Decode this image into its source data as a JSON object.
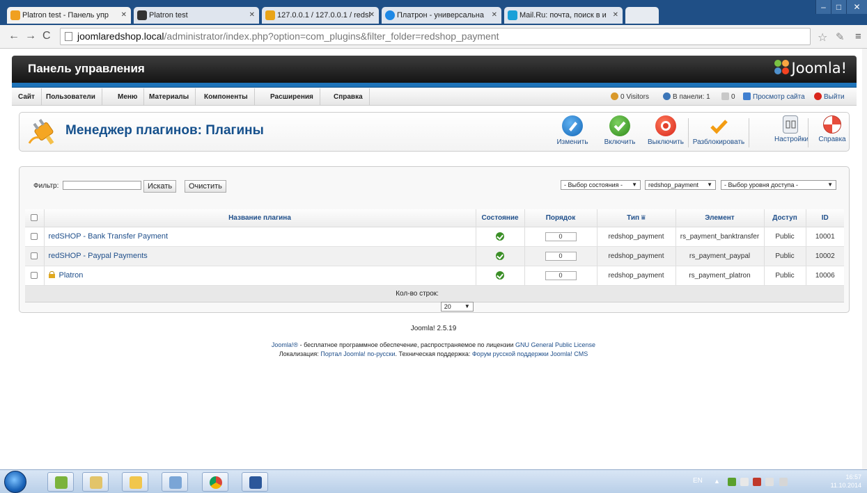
{
  "browser": {
    "tabs": [
      {
        "title": "Platron test - Панель упр",
        "favicon_color": "#f0a020"
      },
      {
        "title": "Platron test",
        "favicon_color": "#333333"
      },
      {
        "title": "127.0.0.1 / 127.0.0.1 / redsl",
        "favicon_color": "#e9a418"
      },
      {
        "title": "Платрон - универсальна",
        "favicon_color": "#1e88e5"
      },
      {
        "title": "Mail.Ru: почта, поиск в и",
        "favicon_color": "#1ba0d8"
      }
    ],
    "address_host": "joomlaredshop.local",
    "address_path": "/administrator/index.php?option=com_plugins&filter_folder=redshop_payment"
  },
  "header": {
    "title": "Панель управления",
    "logo_text": "Joomla!"
  },
  "menu": {
    "items": [
      "Сайт",
      "Пользователи",
      "Меню",
      "Материалы",
      "Компоненты",
      "Расширения",
      "Справка"
    ],
    "visitors": "0 Visitors",
    "in_panel": "В панели: 1",
    "messages": "0",
    "view_site": "Просмотр сайта",
    "logout": "Выйти"
  },
  "toolbar": {
    "title": "Менеджер плагинов: Плагины",
    "buttons": {
      "edit": "Изменить",
      "enable": "Включить",
      "disable": "Выключить",
      "unlock": "Разблокировать",
      "options": "Настройки",
      "help": "Справка"
    }
  },
  "filter": {
    "label": "Фильтр:",
    "value": "",
    "search_button": "Искать",
    "clear_button": "Очистить",
    "state_select": "- Выбор состояния -",
    "folder_select": "redshop_payment",
    "access_select": "- Выбор уровня доступа -"
  },
  "table": {
    "headers": {
      "name": "Название плагина",
      "state": "Состояние",
      "ordering": "Порядок",
      "type": "Тип",
      "element": "Элемент",
      "access": "Доступ",
      "id": "ID"
    },
    "rows": [
      {
        "name": "redSHOP - Bank Transfer Payment",
        "ordering": "0",
        "type": "redshop_payment",
        "element": "rs_payment_banktransfer",
        "access": "Public",
        "id": "10001",
        "locked": false
      },
      {
        "name": "redSHOP - Paypal Payments",
        "ordering": "0",
        "type": "redshop_payment",
        "element": "rs_payment_paypal",
        "access": "Public",
        "id": "10002",
        "locked": false
      },
      {
        "name": "Platron",
        "ordering": "0",
        "type": "redshop_payment",
        "element": "rs_payment_platron",
        "access": "Public",
        "id": "10006",
        "locked": true
      }
    ],
    "rows_label": "Кол-во строк:",
    "rows_value": "20"
  },
  "footer": {
    "version": "Joomla! 2.5.19",
    "line1_link1": "Joomla!®",
    "line1_text": " - бесплатное программное обеспечение, распространяемое по лицензии ",
    "line1_link2": "GNU General Public License",
    "line2_text1": "Локализация: ",
    "line2_link1": "Портал Joomla! по-русски",
    "line2_text2": ". Техническая поддержка: ",
    "line2_link2": "Форум русской поддержки Joomla! CMS"
  },
  "taskbar": {
    "lang": "EN",
    "time": "16:57",
    "date": "11.10.2014"
  }
}
